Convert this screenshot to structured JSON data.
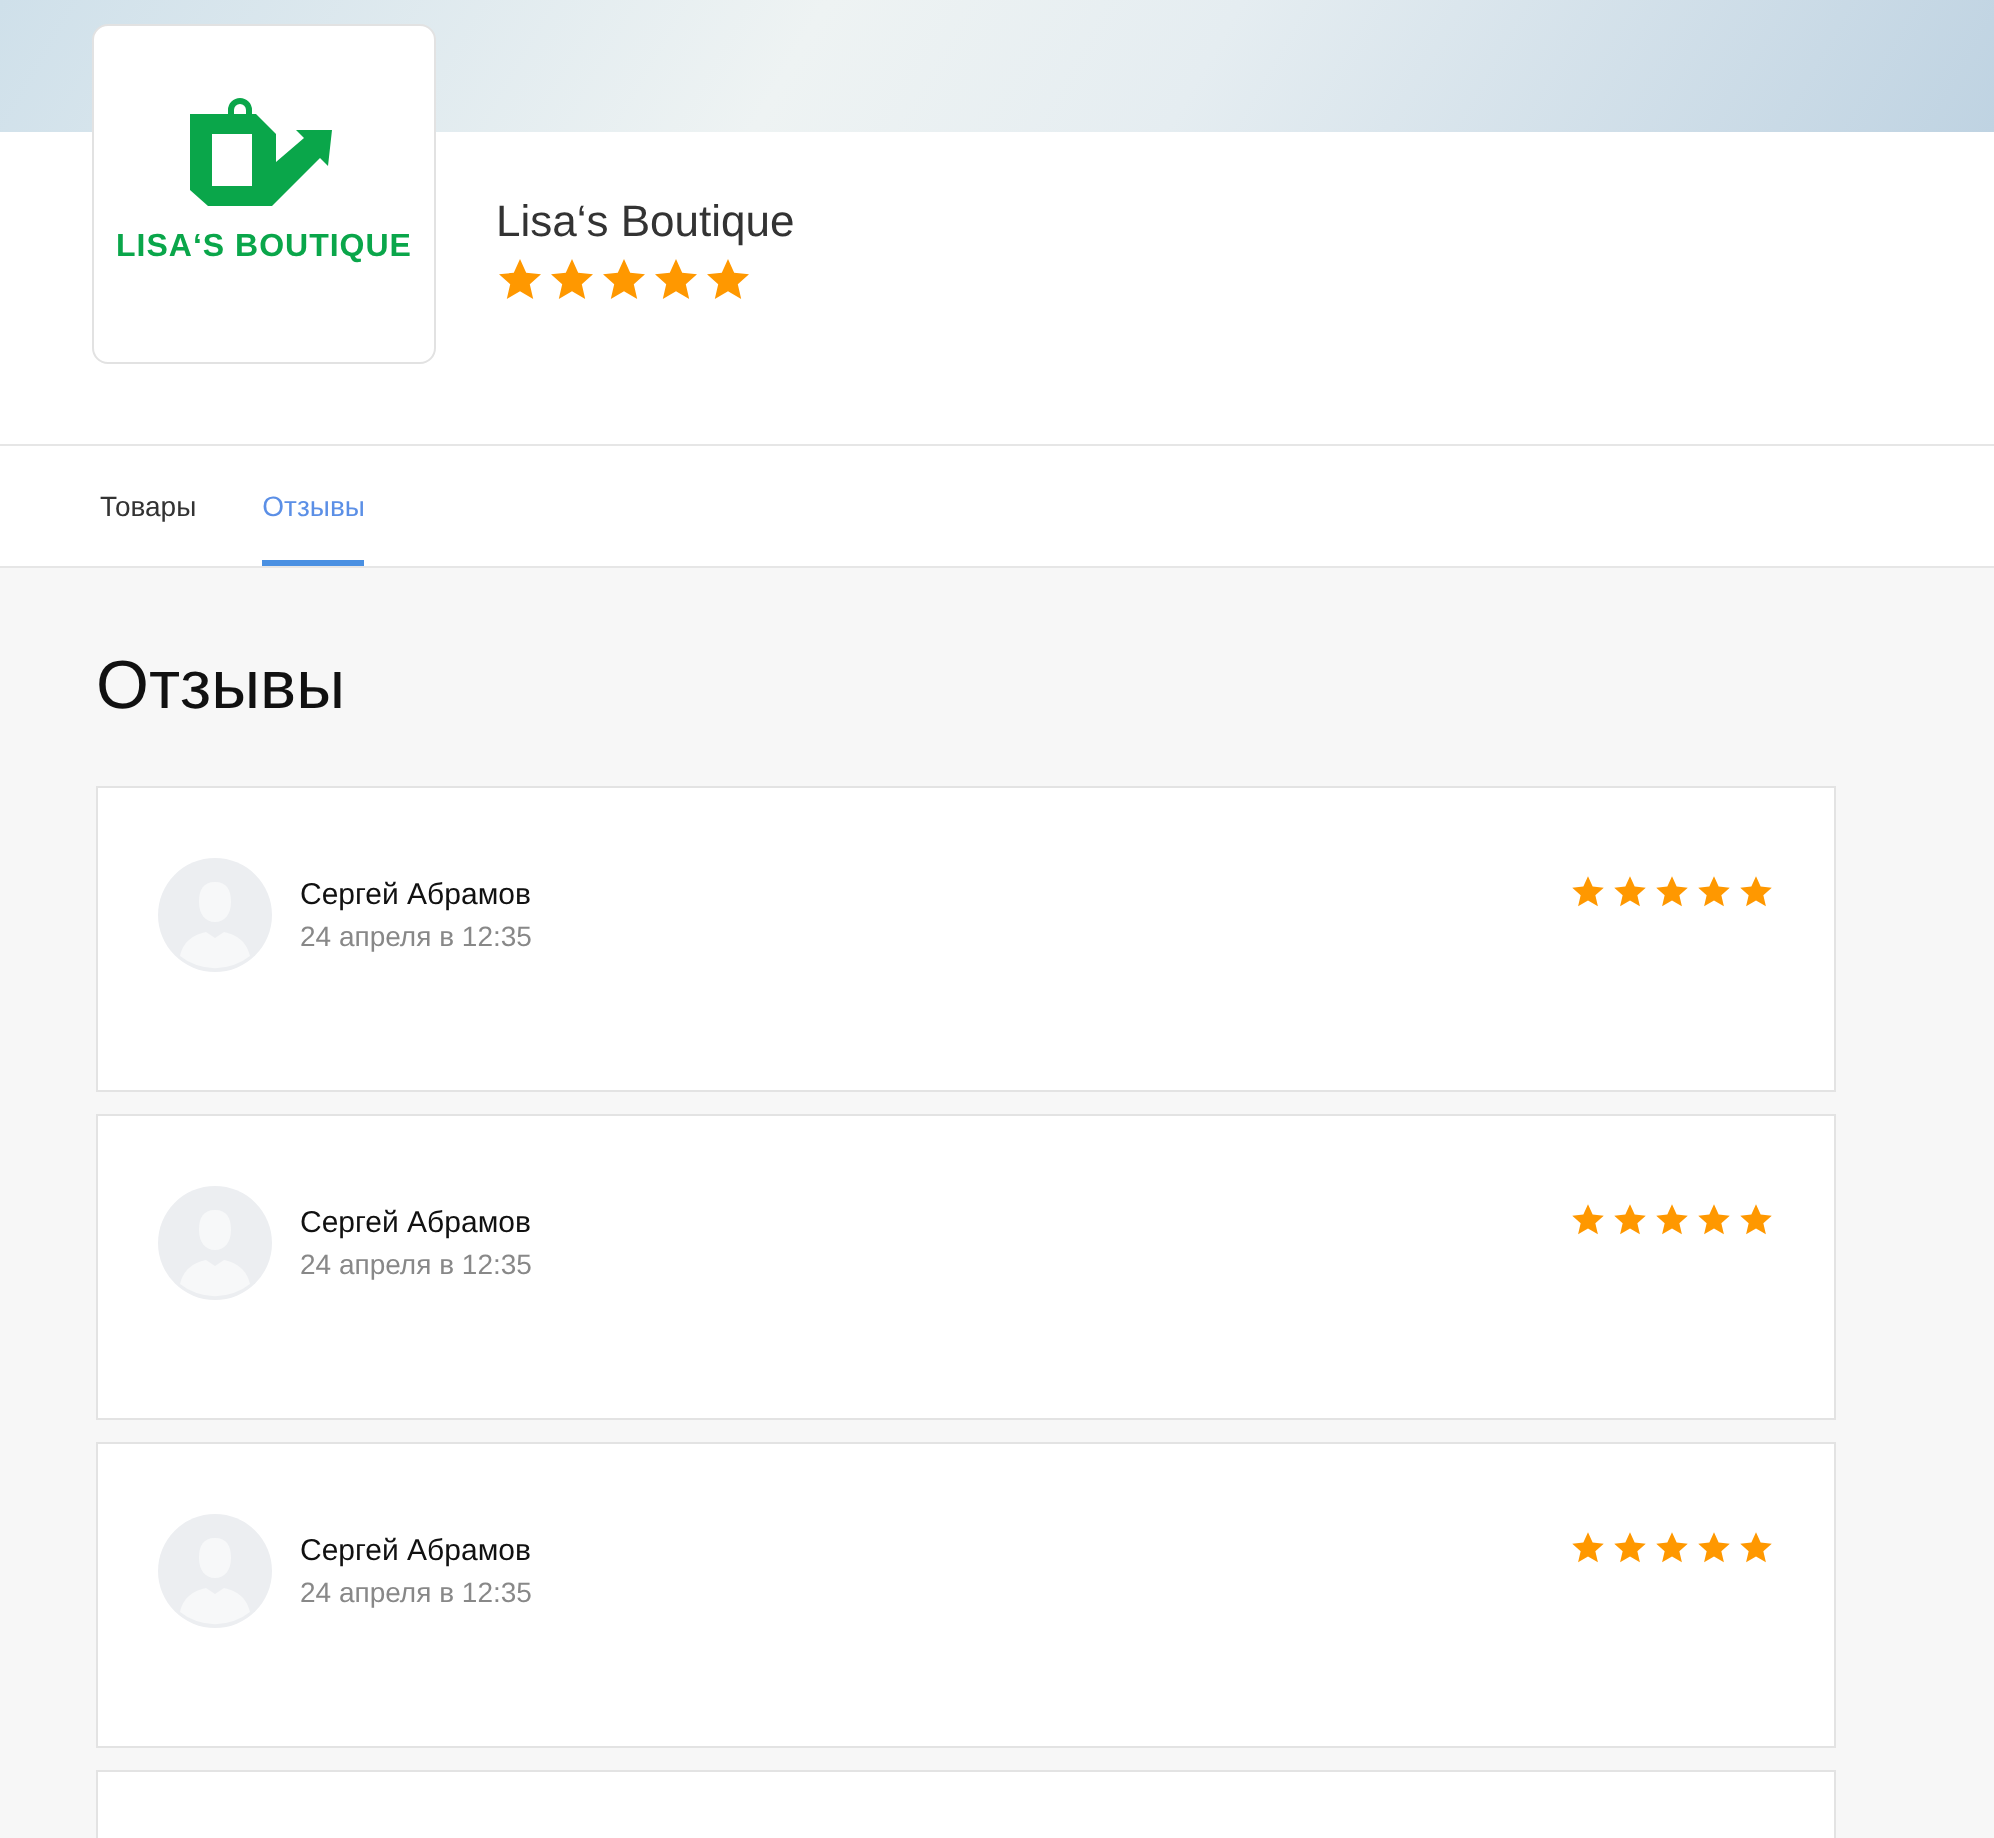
{
  "shop": {
    "logo_text": "LISA‘S BOUTIQUE",
    "name": "Lisa‘s Boutique",
    "stars": 5
  },
  "tabs": [
    {
      "label": "Товары",
      "selected": false
    },
    {
      "label": "Отзывы",
      "selected": true
    }
  ],
  "reviews_title": "Отзывы",
  "reviews": [
    {
      "author": "Сергей Абрамов",
      "date": "24 апреля в 12:35",
      "stars": 5
    },
    {
      "author": "Сергей Абрамов",
      "date": "24 апреля в 12:35",
      "stars": 5
    },
    {
      "author": "Сергей Абрамов",
      "date": "24 апреля в 12:35",
      "stars": 5
    }
  ]
}
